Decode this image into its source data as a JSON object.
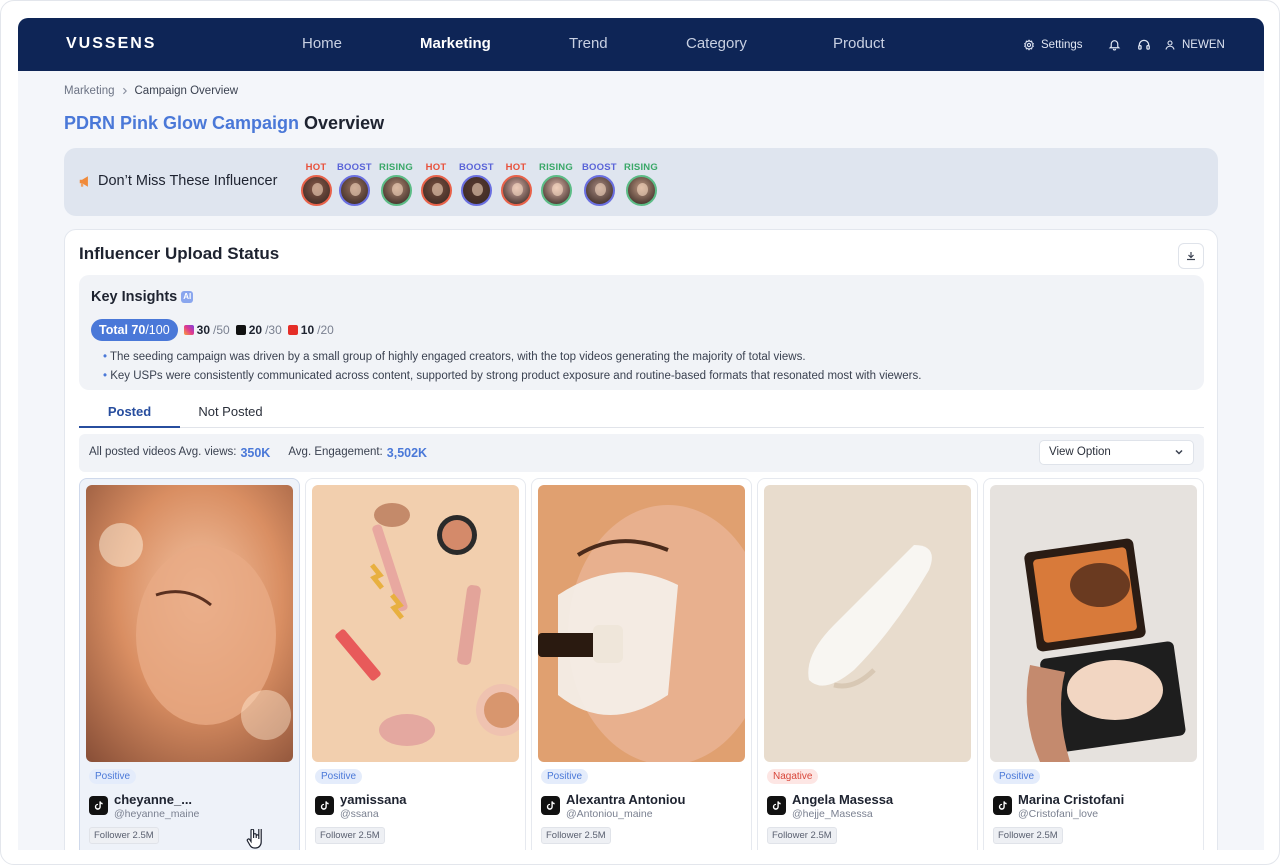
{
  "nav": {
    "logo": "VUSSENS",
    "items": [
      {
        "label": "Home"
      },
      {
        "label": "Marketing"
      },
      {
        "label": "Trend"
      },
      {
        "label": "Category"
      },
      {
        "label": "Product"
      }
    ],
    "settings_label": "Settings",
    "user_label": "NEWEN"
  },
  "breadcrumb": {
    "parent": "Marketing",
    "current": "Campaign Overview"
  },
  "title": {
    "accent": "PDRN Pink Glow Campaign",
    "rest": "Overview"
  },
  "banner": {
    "title": "Don’t Miss These Influencer",
    "influencers": [
      {
        "tag": "HOT",
        "kind": "hot",
        "skin": "#8a5a4a"
      },
      {
        "tag": "BOOST",
        "kind": "boost",
        "skin": "#9a7260"
      },
      {
        "tag": "RISING",
        "kind": "rising",
        "skin": "#b08a74"
      },
      {
        "tag": "HOT",
        "kind": "hot",
        "skin": "#7a5040"
      },
      {
        "tag": "BOOST",
        "kind": "boost",
        "skin": "#5a3a30"
      },
      {
        "tag": "HOT",
        "kind": "hot",
        "skin": "#d8b0a8"
      },
      {
        "tag": "RISING",
        "kind": "rising",
        "skin": "#e0b8ac"
      },
      {
        "tag": "BOOST",
        "kind": "boost",
        "skin": "#a88a80"
      },
      {
        "tag": "RISING",
        "kind": "rising",
        "skin": "#c09a84"
      }
    ]
  },
  "upload": {
    "title": "Influencer Upload Status",
    "insights": {
      "title": "Key Insights",
      "ai_badge": "AI",
      "total_label": "Total",
      "total_value": "70",
      "total_max": "/100",
      "instagram": {
        "value": "30",
        "max": "/50"
      },
      "tiktok": {
        "value": "20",
        "max": "/30"
      },
      "youtube": {
        "value": "10",
        "max": "/20"
      },
      "bullets": [
        "The seeding campaign was driven by a small group of highly engaged creators, with the top videos generating the majority of total views.",
        "Key USPs were consistently communicated across content, supported by strong product exposure and routine-based formats that resonated most with viewers."
      ]
    },
    "tabs": [
      {
        "label": "Posted"
      },
      {
        "label": "Not Posted"
      }
    ],
    "stats": {
      "views_label": "All posted videos Avg. views:",
      "views_value": "350K",
      "engagement_label": "Avg. Engagement:",
      "engagement_value": "3,502K",
      "view_option": "View Option"
    },
    "videos": [
      {
        "sentiment": "Positive",
        "name": "cheyanne_...",
        "handle": "@heyanne_maine",
        "follower": "Follower 2.5M"
      },
      {
        "sentiment": "Positive",
        "name": "yamissana",
        "handle": "@ssana",
        "follower": "Follower 2.5M"
      },
      {
        "sentiment": "Positive",
        "name": "Alexantra Antoniou",
        "handle": "@Antoniou_maine",
        "follower": "Follower 2.5M"
      },
      {
        "sentiment": "Nagative",
        "name": "Angela Masessa",
        "handle": "@hejje_Masessa",
        "follower": "Follower 2.5M"
      },
      {
        "sentiment": "Positive",
        "name": "Marina Cristofani",
        "handle": "@Cristofani_love",
        "follower": "Follower 2.5M"
      }
    ]
  },
  "colors": {
    "nav_bg": "#0e2556",
    "accent": "#4a78d8",
    "hot": "#e8503a",
    "boost": "#5a64d8",
    "rising": "#3aa868",
    "negative": "#d8463a"
  }
}
